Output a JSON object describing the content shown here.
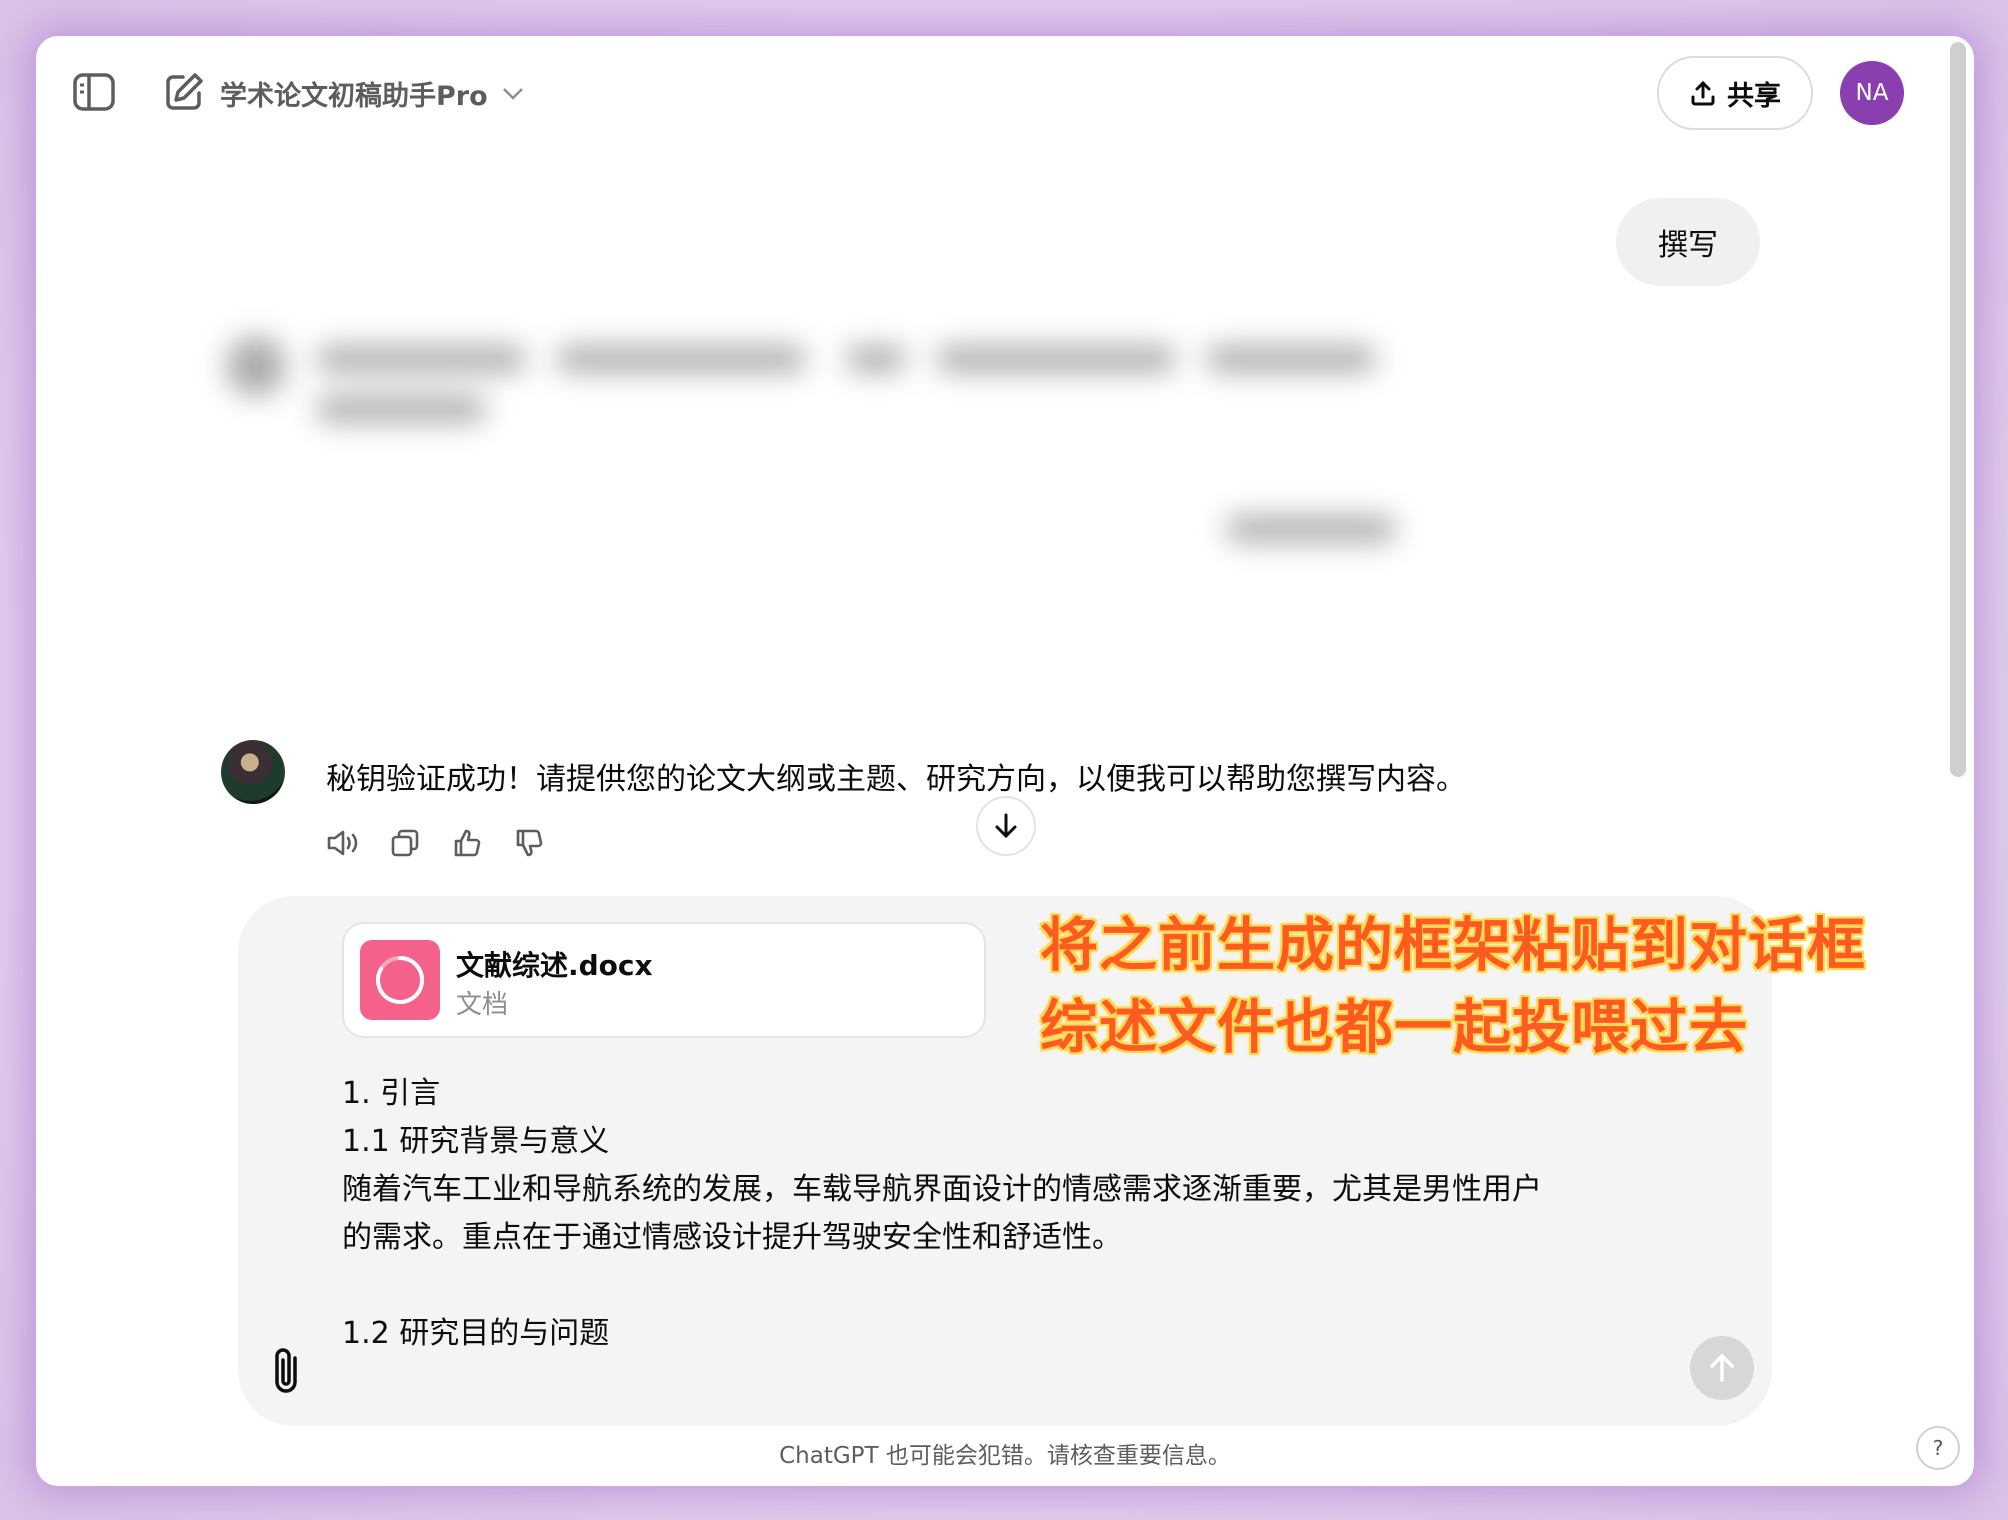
{
  "header": {
    "title": "学术论文初稿助手Pro",
    "share_label": "共享",
    "avatar_initials": "NA"
  },
  "conversation": {
    "user_message": "撰写",
    "assistant_message": "秘钥验证成功！请提供您的论文大纲或主题、研究方向，以便我可以帮助您撰写内容。"
  },
  "composer": {
    "attachment": {
      "name": "文献综述.docx",
      "type": "文档"
    },
    "lines": [
      "1. 引言",
      "1.1 研究背景与意义",
      "随着汽车工业和导航系统的发展，车载导航界面设计的情感需求逐渐重要，尤其是男性用户",
      "的需求。重点在于通过情感设计提升驾驶安全性和舒适性。",
      "",
      "1.2 研究目的与问题"
    ]
  },
  "footer": {
    "disclaimer": "ChatGPT 也可能会犯错。请核查重要信息。",
    "help_label": "?"
  },
  "annotation": {
    "line1": "将之前生成的框架粘贴到对话框",
    "line2": "综述文件也都一起投喂过去"
  },
  "colors": {
    "avatar_bg": "#8a3fb0",
    "file_icon_bg": "#f4628b",
    "annotation_text": "#ff5a1f",
    "annotation_glow": "#ffd23a"
  },
  "icons": [
    "sidebar-toggle-icon",
    "new-chat-icon",
    "chevron-down-icon",
    "upload-icon",
    "speaker-icon",
    "copy-icon",
    "thumbs-up-icon",
    "thumbs-down-icon",
    "arrow-down-icon",
    "paperclip-icon",
    "arrow-up-icon",
    "spinner-icon"
  ]
}
